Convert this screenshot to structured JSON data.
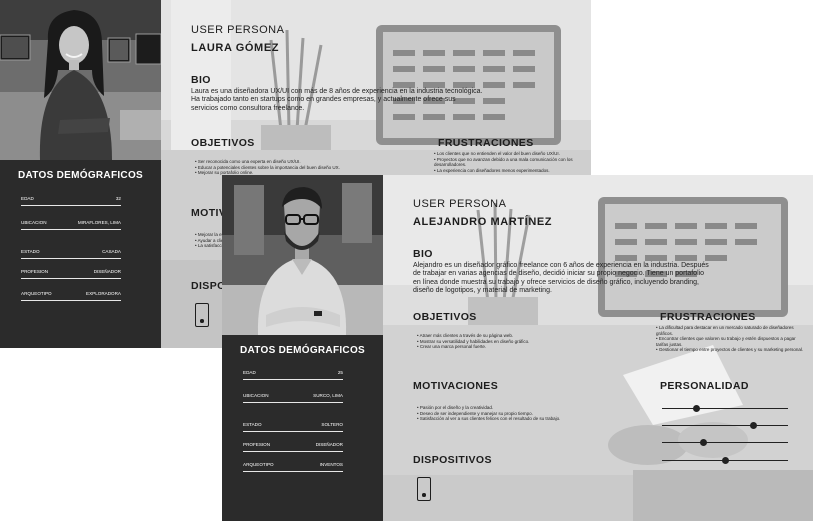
{
  "persona1": {
    "kicker": "USER PERSONA",
    "name": "LAURA GÓMEZ",
    "bio_title": "BIO",
    "bio_lines": [
      "Laura es una diseñadora UX/UI con más de 8 años de experiencia en la industria tecnológica.",
      "Ha trabajado tanto en startups como en grandes empresas, y actualmente ofrece sus",
      "servicios como consultora freelance."
    ],
    "objetivos_title": "OBJETIVOS",
    "objetivos": [
      "Ser reconocida como una experta en diseño UX/UI.",
      "Educar a potenciales clientes sobre la importancia del buen diseño UX.",
      "Mejorar su portafolio online."
    ],
    "frustraciones_title": "FRUSTRACIONES",
    "frustraciones": [
      "Los clientes que no entienden el valor del buen diseño UX/UI.",
      "Proyectos que no avanzan debido a una mala comunicación con los desarrolladores.",
      "La experiencia con diseñadores menos experimentados."
    ],
    "motivaciones_title": "MOTIVACIONES",
    "motivaciones": [
      "Mejorar la experiencia de usuario.",
      "Ayudar a clientes a lograr sus objetivos.",
      "La satisfacción de un trabajo bien hecho."
    ],
    "dispositivos_title": "DISPOSITIVOS",
    "demo_title": "DATOS DEMÓGRAFICOS",
    "demo": [
      {
        "k": "EDAD",
        "v": "32"
      },
      {
        "k": "UBICACION",
        "v": "MIRAFLORES, LIMA"
      },
      {
        "k": "ESTADO",
        "v": "CASADA"
      },
      {
        "k": "PROFESION",
        "v": "DISEÑADOR"
      },
      {
        "k": "ARQUEOTIPO",
        "v": "EXPLORADORA"
      }
    ]
  },
  "persona2": {
    "kicker": "USER PERSONA",
    "name": "ALEJANDRO MARTÍNEZ",
    "bio_title": "BIO",
    "bio_lines": [
      "Alejandro es un diseñador gráfico freelance con 6 años de experiencia en la industria. Después",
      "de trabajar en varias agencias de diseño, decidió iniciar su propio negocio. Tiene un portafolio",
      "en línea donde muestra su trabajo y ofrece servicios de diseño gráfico, incluyendo branding,",
      "diseño de logotipos, y material de marketing."
    ],
    "objetivos_title": "OBJETIVOS",
    "objetivos": [
      "Atraer más clientes a través de su página web.",
      "Mostrar su versatilidad y habilidades en diseño gráfico.",
      "Crear una marca personal fuerte."
    ],
    "frustraciones_title": "FRUSTRACIONES",
    "frustraciones": [
      "La dificultad para destacar en un mercado saturado de diseñadores gráficos.",
      "Encontrar clientes que valoren su trabajo y estén dispuestos a pagar tarifas justas.",
      "Gestionar el tiempo entre proyectos de clientes y su marketing personal."
    ],
    "motivaciones_title": "MOTIVACIONES",
    "motivaciones": [
      "Pasión por el diseño y la creatividad.",
      "Deseo de ser independiente y manejar su propio tiempo.",
      "Satisfacción al ver a sus clientes felices con el resultado de su trabajo."
    ],
    "personalidad_title": "PERSONALIDAD",
    "personalidad": [
      0.27,
      0.73,
      0.33,
      0.5
    ],
    "dispositivos_title": "DISPOSITIVOS",
    "demo_title": "DATOS DEMÓGRAFICOS",
    "demo": [
      {
        "k": "EDAD",
        "v": "25"
      },
      {
        "k": "UBICACION",
        "v": "SURCO, LIMA"
      },
      {
        "k": "ESTADO",
        "v": "SOLTERO"
      },
      {
        "k": "PROFESION",
        "v": "DISEÑADOR"
      },
      {
        "k": "ARQUEOTIPO",
        "v": "INVENTOS"
      }
    ]
  }
}
